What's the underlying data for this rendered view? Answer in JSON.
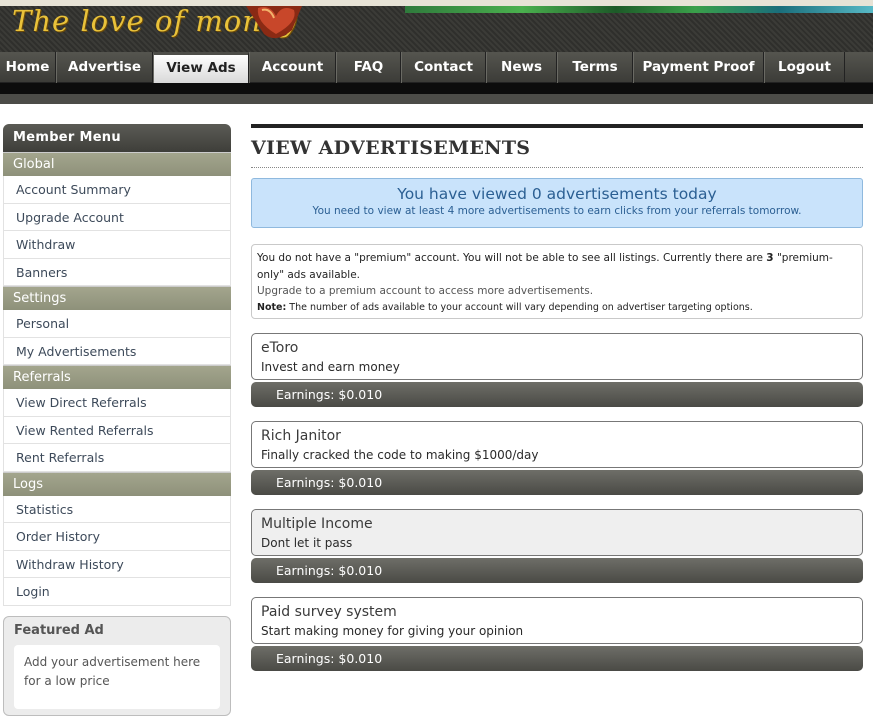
{
  "brand": {
    "logo_text": "The love of money"
  },
  "nav": {
    "items": [
      "Home",
      "Advertise",
      "View Ads",
      "Account",
      "FAQ",
      "Contact",
      "News",
      "Terms",
      "Payment Proof",
      "Logout"
    ],
    "active": "View Ads"
  },
  "sidebar": {
    "title": "Member Menu",
    "global_label": "Global",
    "global": [
      "Account Summary",
      "Upgrade Account",
      "Withdraw",
      "Banners"
    ],
    "settings_label": "Settings",
    "settings": [
      "Personal",
      "My Advertisements"
    ],
    "referrals_label": "Referrals",
    "referrals": [
      "View Direct Referrals",
      "View Rented Referrals",
      "Rent Referrals"
    ],
    "logs_label": "Logs",
    "logs": [
      "Statistics",
      "Order History",
      "Withdraw History",
      "Login"
    ],
    "featured_title": "Featured Ad",
    "featured_text": "Add your advertisement here for a low price"
  },
  "main": {
    "title": "VIEW ADVERTISEMENTS",
    "viewed_headline": "You have viewed 0 advertisements today",
    "viewed_sub": "You need to view at least 4 more advertisements to earn clicks from your referrals tomorrow.",
    "notice_part1": "You do not have a \"premium\" account. You will not be able to see all listings. Currently there are ",
    "notice_count": "3",
    "notice_part2": " \"premium-only\" ads available.",
    "upgrade_text": "Upgrade to a premium account to access more advertisements.",
    "note_label": "Note:",
    "note_text": " The number of ads available to your account will vary depending on advertiser targeting options.",
    "ads": [
      {
        "title": "eToro",
        "desc": "Invest and earn money",
        "earnings": "Earnings: $0.010"
      },
      {
        "title": "Rich Janitor",
        "desc": "Finally cracked the code to making $1000/day",
        "earnings": "Earnings: $0.010"
      },
      {
        "title": "Multiple Income",
        "desc": "Dont let it pass",
        "earnings": "Earnings: $0.010"
      },
      {
        "title": "Paid survey system",
        "desc": "Start making money for giving your opinion",
        "earnings": "Earnings: $0.010"
      }
    ]
  },
  "colors": {
    "accent": "#e9c23a",
    "info_bg": "#c9e3fb",
    "info_text": "#2b5f93",
    "menu_group": "#9a9c85"
  }
}
